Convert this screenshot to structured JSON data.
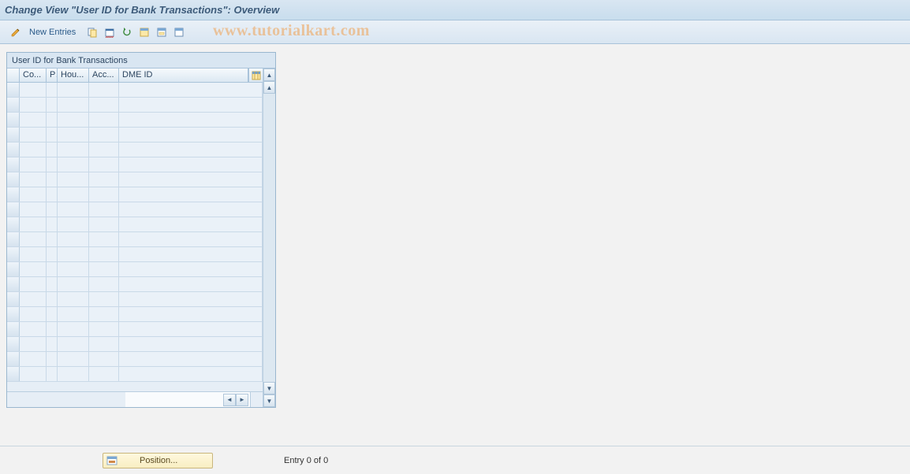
{
  "title": "Change View \"User ID for Bank Transactions\": Overview",
  "toolbar": {
    "new_entries_label": "New Entries"
  },
  "watermark": "www.tutorialkart.com",
  "table": {
    "title": "User ID for Bank Transactions",
    "columns": {
      "co": "Co...",
      "p": "P",
      "hou": "Hou...",
      "acc": "Acc...",
      "dme": "DME ID"
    },
    "rows": []
  },
  "footer": {
    "position_label": "Position...",
    "entry_text": "Entry 0 of 0"
  }
}
